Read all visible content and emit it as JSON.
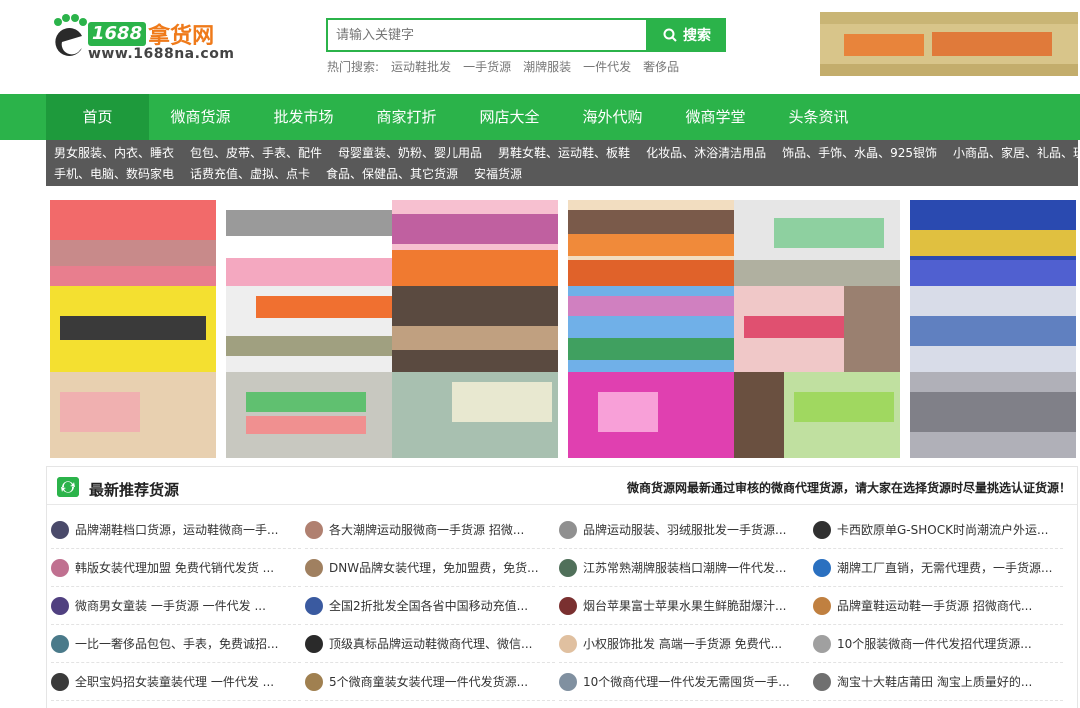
{
  "logo": {
    "number": "1688",
    "name": "拿货网",
    "url": "www.1688na.com"
  },
  "search": {
    "placeholder": "请输入关键字",
    "button": "搜索",
    "hot_label": "热门搜索:",
    "hot_terms": [
      "运动鞋批发",
      "一手货源",
      "潮牌服装",
      "一件代发",
      "奢侈品"
    ]
  },
  "nav": [
    "首页",
    "微商货源",
    "批发市场",
    "商家打折",
    "网店大全",
    "海外代购",
    "微商学堂",
    "头条资讯"
  ],
  "categories": {
    "row1": [
      "男女服装、内衣、睡衣",
      "包包、皮带、手表、配件",
      "母婴童装、奶粉、婴儿用品",
      "男鞋女鞋、运动鞋、板鞋",
      "化妆品、沐浴清洁用品",
      "饰品、手饰、水晶、925银饰",
      "小商品、家居、礼品、玩具"
    ],
    "row2": [
      "手机、电脑、数码家电",
      "话费充值、虚拟、点卡",
      "食品、保健品、其它货源",
      "安福货源"
    ]
  },
  "recommend": {
    "title": "最新推荐货源",
    "note": "微商货源网最新通过审核的微商代理货源，请大家在选择货源时尽量挑选认证货源！",
    "items": [
      [
        "品牌潮鞋档口货源，运动鞋微商一手...",
        "各大潮牌运动服微商一手货源 招微...",
        "品牌运动服装、羽绒服批发一手货源...",
        "卡西欧原单G-SHOCK时尚潮流户外运..."
      ],
      [
        "韩版女装代理加盟 免费代销代发货 ...",
        "DNW品牌女装代理，免加盟费，免货...",
        "江苏常熟潮牌服装档口潮牌一件代发...",
        "潮牌工厂直销，无需代理费，一手货源..."
      ],
      [
        "微商男女童装 一手货源 一件代发 ...",
        "全国2折批发全国各省中国移动充值...",
        "烟台苹果富士苹果水果生鲜脆甜爆汁...",
        "品牌童鞋运动鞋一手货源 招微商代..."
      ],
      [
        "一比一奢侈品包包、手表，免费诚招...",
        "顶级真标品牌运动鞋微商代理、微信...",
        "小权服饰批发 高端一手货源 免费代...",
        "10个服装微商一件代发招代理货源..."
      ],
      [
        "全职宝妈招女装童装代理 一件代发 ...",
        "5个微商童装女装代理一件代发货源...",
        "10个微商代理一件代发无需囤货一手...",
        "淘宝十大鞋店莆田 淘宝上质量好的..."
      ]
    ]
  },
  "colors": {
    "brand_green": "#2bb34a",
    "nav_active": "#1e9a3c",
    "category_bar": "#595959",
    "logo_orange": "#ef7a1a"
  }
}
